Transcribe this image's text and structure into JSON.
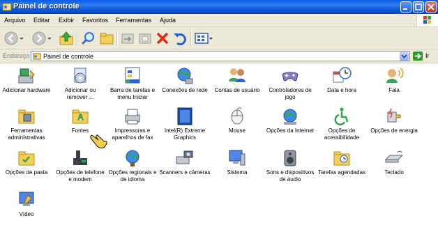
{
  "window": {
    "title": "Painel de controle"
  },
  "menubar": {
    "items": [
      "Arquivo",
      "Editar",
      "Exibir",
      "Favoritos",
      "Ferramentas",
      "Ajuda"
    ]
  },
  "address": {
    "label": "Endereço",
    "value": "Painel de controle",
    "go_label": "Ir"
  },
  "items": [
    {
      "label": "Adicionar hardware",
      "icon": "hardware-icon"
    },
    {
      "label": "Adicionar ou remover ...",
      "icon": "add-remove-programs-icon"
    },
    {
      "label": "Barra de tarefas e menu Iniciar",
      "icon": "taskbar-icon"
    },
    {
      "label": "Conexões de rede",
      "icon": "network-connections-icon"
    },
    {
      "label": "Contas de usuário",
      "icon": "user-accounts-icon"
    },
    {
      "label": "Controladores de jogo",
      "icon": "game-controllers-icon"
    },
    {
      "label": "Data e hora",
      "icon": "date-time-icon"
    },
    {
      "label": "Fala",
      "icon": "speech-icon"
    },
    {
      "label": "Ferramentas administrativas",
      "icon": "admin-tools-icon"
    },
    {
      "label": "Fontes",
      "icon": "fonts-folder-icon"
    },
    {
      "label": "Impressoras e aparelhos de fax",
      "icon": "printers-icon"
    },
    {
      "label": "Intel(R) Extreme Graphics",
      "icon": "intel-graphics-icon"
    },
    {
      "label": "Mouse",
      "icon": "mouse-icon"
    },
    {
      "label": "Opções da Internet",
      "icon": "internet-options-icon"
    },
    {
      "label": "Opções de acessibilidade",
      "icon": "accessibility-icon"
    },
    {
      "label": "Opções de energia",
      "icon": "power-options-icon"
    },
    {
      "label": "Opções de pasta",
      "icon": "folder-options-icon"
    },
    {
      "label": "Opções de telefone e modem",
      "icon": "phone-modem-icon"
    },
    {
      "label": "Opções regionais e de idioma",
      "icon": "regional-options-icon"
    },
    {
      "label": "Scanners e câmeras",
      "icon": "scanners-cameras-icon"
    },
    {
      "label": "Sistema",
      "icon": "system-icon"
    },
    {
      "label": "Sons e dispositivos de áudio",
      "icon": "sounds-audio-icon"
    },
    {
      "label": "Tarefas agendadas",
      "icon": "scheduled-tasks-icon"
    },
    {
      "label": "Teclado",
      "icon": "keyboard-icon"
    },
    {
      "label": "Vídeo",
      "icon": "video-icon"
    }
  ]
}
